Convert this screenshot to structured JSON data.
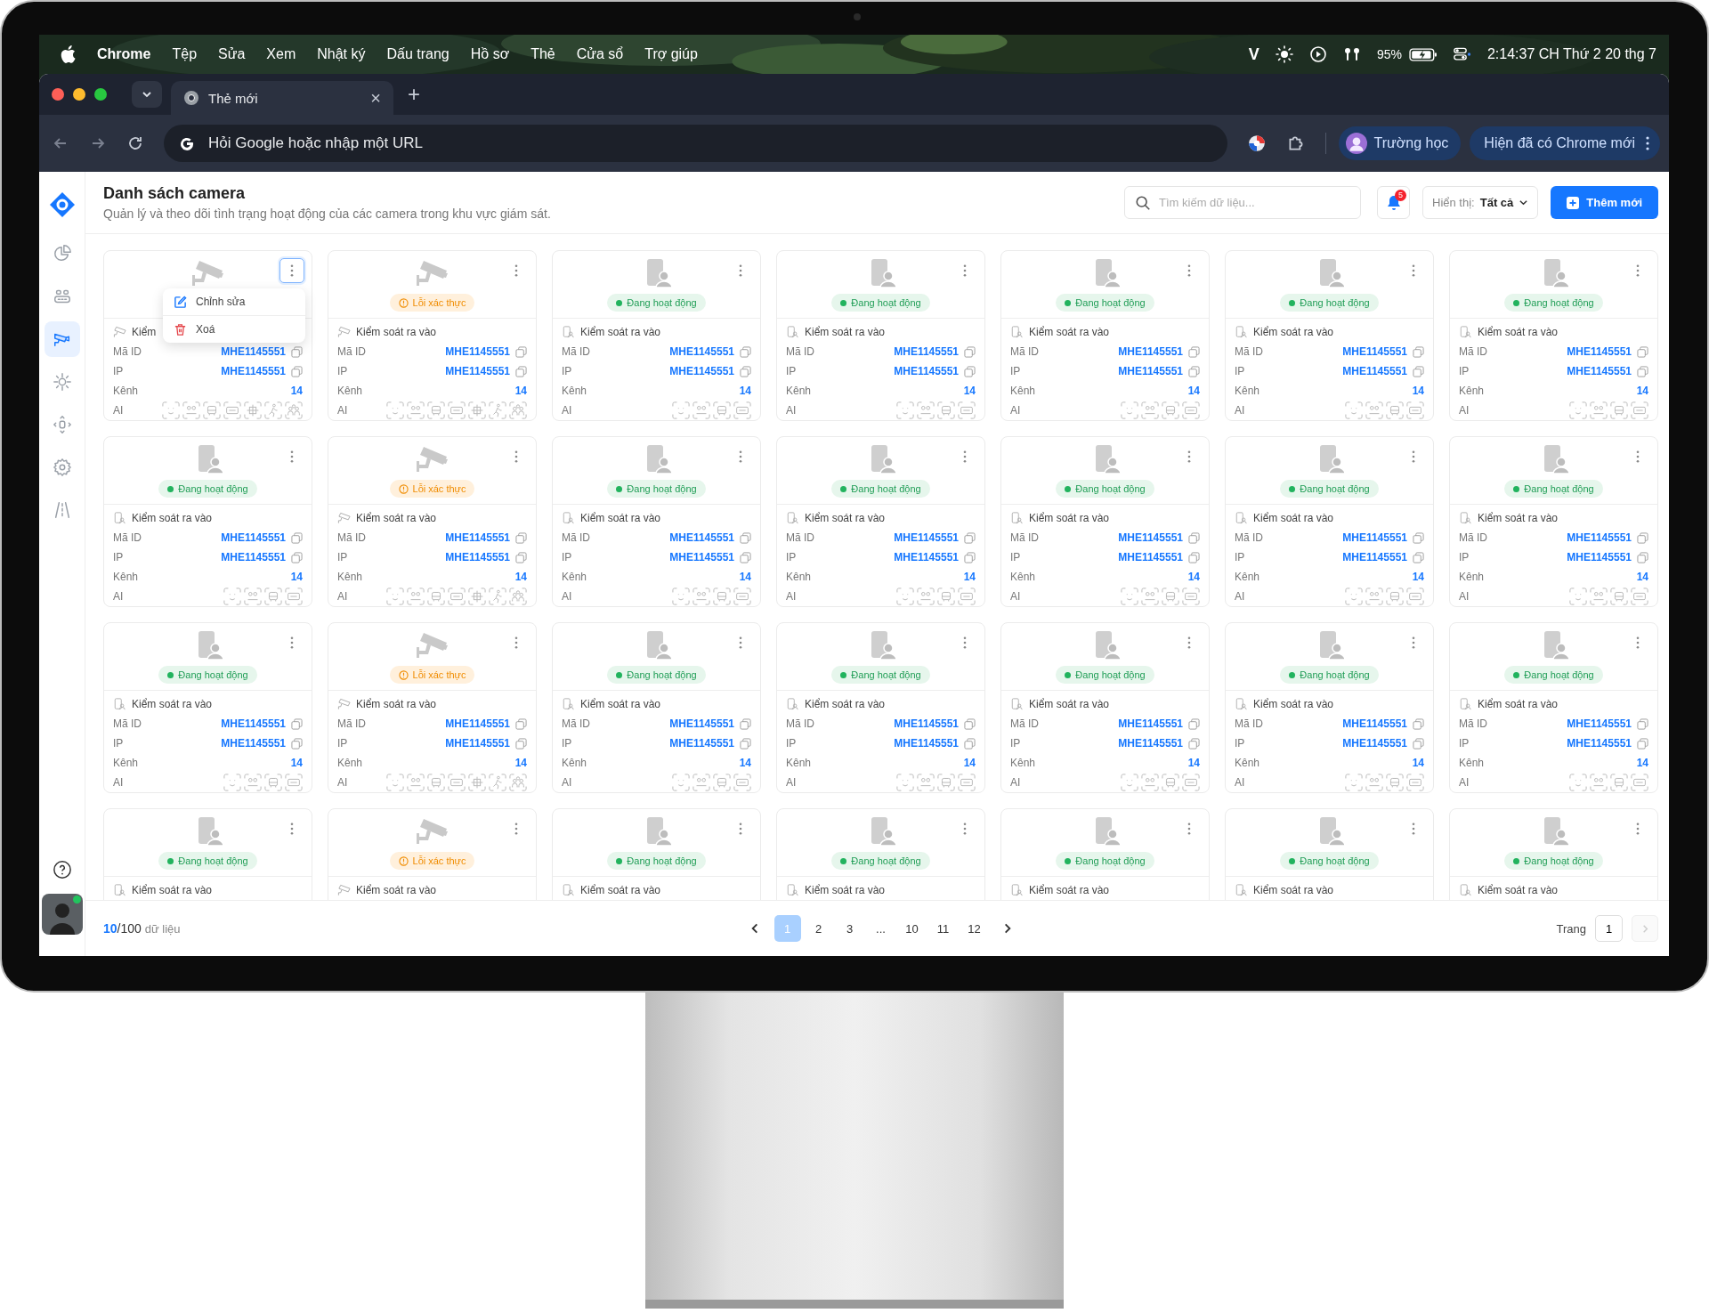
{
  "menubar": {
    "app": "Chrome",
    "items": [
      "Tệp",
      "Sửa",
      "Xem",
      "Nhật ký",
      "Dấu trang",
      "Hồ sơ",
      "Thẻ",
      "Cửa sổ",
      "Trợ giúp"
    ],
    "input_mode": "V",
    "battery": "95%",
    "clock": "2:14:37 CH Thứ 2 20 thg 7"
  },
  "browser": {
    "tabs": [
      {
        "title": "Thẻ mới",
        "selected": true,
        "close": "×"
      }
    ],
    "new_tab": "+",
    "address_placeholder": "Hỏi Google hoặc nhập một URL",
    "profile": "Trường học",
    "update": "Hiện đã có Chrome mới"
  },
  "sidebar": {
    "items": [
      {
        "kind": "chart",
        "selected": false
      },
      {
        "kind": "devices",
        "selected": false
      },
      {
        "kind": "camera",
        "selected": true
      },
      {
        "kind": "sensor",
        "selected": false
      },
      {
        "kind": "move",
        "selected": false
      },
      {
        "kind": "settings",
        "selected": false
      },
      {
        "kind": "road",
        "selected": false
      }
    ],
    "user_online": true
  },
  "header": {
    "title": "Danh sách camera",
    "subtitle": "Quản lý và theo dõi tình trạng hoạt động của các camera trong khu vực giám sát.",
    "search_placeholder": "Tìm kiếm dữ liệu...",
    "notifications": "5",
    "filter_label": "Hiển thị:",
    "filter_value": "Tất cả",
    "add_button": "Thêm mới"
  },
  "cards": [
    {
      "kind": "camera",
      "menu_open": true,
      "menu": [
        {
          "kind": "edit",
          "label": "Chỉnh sửa"
        },
        {
          "kind": "delete",
          "label": "Xoá"
        }
      ],
      "type": "Kiểm",
      "id_label": "Mã ID",
      "id": "MHE1145551",
      "ip_label": "IP",
      "ip": "MHE1145551",
      "channel_label": "Kênh",
      "channel": "14",
      "ai_label": "AI",
      "ai": [
        {
          "kind": "face"
        },
        {
          "kind": "people"
        },
        {
          "kind": "car"
        },
        {
          "kind": "plate"
        },
        {
          "kind": "crop"
        },
        {
          "kind": "walk"
        },
        {
          "kind": "group"
        }
      ]
    },
    {
      "kind": "camera",
      "status": {
        "kind": "error",
        "label": "Lỗi xác thực"
      },
      "menu_open": false,
      "type": "Kiểm soát ra vào",
      "id_label": "Mã ID",
      "id": "MHE1145551",
      "ip_label": "IP",
      "ip": "MHE1145551",
      "channel_label": "Kênh",
      "channel": "14",
      "ai_label": "AI",
      "ai": [
        {
          "kind": "face"
        },
        {
          "kind": "people"
        },
        {
          "kind": "car"
        },
        {
          "kind": "plate"
        },
        {
          "kind": "crop"
        },
        {
          "kind": "walk"
        },
        {
          "kind": "group"
        }
      ]
    },
    {
      "kind": "door",
      "status": {
        "kind": "active",
        "label": "Đang hoạt động"
      },
      "menu_open": false,
      "type": "Kiểm soát ra vào",
      "id_label": "Mã ID",
      "id": "MHE1145551",
      "ip_label": "IP",
      "ip": "MHE1145551",
      "channel_label": "Kênh",
      "channel": "14",
      "ai_label": "AI",
      "ai": [
        {
          "kind": "face"
        },
        {
          "kind": "people"
        },
        {
          "kind": "car"
        },
        {
          "kind": "plate"
        }
      ]
    },
    {
      "kind": "door",
      "status": {
        "kind": "active",
        "label": "Đang hoạt động"
      },
      "menu_open": false,
      "type": "Kiểm soát ra vào",
      "id_label": "Mã ID",
      "id": "MHE1145551",
      "ip_label": "IP",
      "ip": "MHE1145551",
      "channel_label": "Kênh",
      "channel": "14",
      "ai_label": "AI",
      "ai": [
        {
          "kind": "face"
        },
        {
          "kind": "people"
        },
        {
          "kind": "car"
        },
        {
          "kind": "plate"
        }
      ]
    },
    {
      "kind": "door",
      "status": {
        "kind": "active",
        "label": "Đang hoạt động"
      },
      "menu_open": false,
      "type": "Kiểm soát ra vào",
      "id_label": "Mã ID",
      "id": "MHE1145551",
      "ip_label": "IP",
      "ip": "MHE1145551",
      "channel_label": "Kênh",
      "channel": "14",
      "ai_label": "AI",
      "ai": [
        {
          "kind": "face"
        },
        {
          "kind": "people"
        },
        {
          "kind": "car"
        },
        {
          "kind": "plate"
        }
      ]
    },
    {
      "kind": "door",
      "status": {
        "kind": "active",
        "label": "Đang hoạt động"
      },
      "menu_open": false,
      "type": "Kiểm soát ra vào",
      "id_label": "Mã ID",
      "id": "MHE1145551",
      "ip_label": "IP",
      "ip": "MHE1145551",
      "channel_label": "Kênh",
      "channel": "14",
      "ai_label": "AI",
      "ai": [
        {
          "kind": "face"
        },
        {
          "kind": "people"
        },
        {
          "kind": "car"
        },
        {
          "kind": "plate"
        }
      ]
    },
    {
      "kind": "door",
      "status": {
        "kind": "active",
        "label": "Đang hoạt động"
      },
      "menu_open": false,
      "type": "Kiểm soát ra vào",
      "id_label": "Mã ID",
      "id": "MHE1145551",
      "ip_label": "IP",
      "ip": "MHE1145551",
      "channel_label": "Kênh",
      "channel": "14",
      "ai_label": "AI",
      "ai": [
        {
          "kind": "face"
        },
        {
          "kind": "people"
        },
        {
          "kind": "car"
        },
        {
          "kind": "plate"
        }
      ]
    },
    {
      "kind": "door",
      "status": {
        "kind": "active",
        "label": "Đang hoạt động"
      },
      "menu_open": false,
      "type": "Kiểm soát ra vào",
      "id_label": "Mã ID",
      "id": "MHE1145551",
      "ip_label": "IP",
      "ip": "MHE1145551",
      "channel_label": "Kênh",
      "channel": "14",
      "ai_label": "AI",
      "ai": [
        {
          "kind": "face"
        },
        {
          "kind": "people"
        },
        {
          "kind": "car"
        },
        {
          "kind": "plate"
        }
      ]
    },
    {
      "kind": "camera",
      "status": {
        "kind": "error",
        "label": "Lỗi xác thực"
      },
      "menu_open": false,
      "type": "Kiểm soát ra vào",
      "id_label": "Mã ID",
      "id": "MHE1145551",
      "ip_label": "IP",
      "ip": "MHE1145551",
      "channel_label": "Kênh",
      "channel": "14",
      "ai_label": "AI",
      "ai": [
        {
          "kind": "face"
        },
        {
          "kind": "people"
        },
        {
          "kind": "car"
        },
        {
          "kind": "plate"
        },
        {
          "kind": "crop"
        },
        {
          "kind": "walk"
        },
        {
          "kind": "group"
        }
      ]
    },
    {
      "kind": "door",
      "status": {
        "kind": "active",
        "label": "Đang hoạt động"
      },
      "menu_open": false,
      "type": "Kiểm soát ra vào",
      "id_label": "Mã ID",
      "id": "MHE1145551",
      "ip_label": "IP",
      "ip": "MHE1145551",
      "channel_label": "Kênh",
      "channel": "14",
      "ai_label": "AI",
      "ai": [
        {
          "kind": "face"
        },
        {
          "kind": "people"
        },
        {
          "kind": "car"
        },
        {
          "kind": "plate"
        }
      ]
    },
    {
      "kind": "door",
      "status": {
        "kind": "active",
        "label": "Đang hoạt động"
      },
      "menu_open": false,
      "type": "Kiểm soát ra vào",
      "id_label": "Mã ID",
      "id": "MHE1145551",
      "ip_label": "IP",
      "ip": "MHE1145551",
      "channel_label": "Kênh",
      "channel": "14",
      "ai_label": "AI",
      "ai": [
        {
          "kind": "face"
        },
        {
          "kind": "people"
        },
        {
          "kind": "car"
        },
        {
          "kind": "plate"
        }
      ]
    },
    {
      "kind": "door",
      "status": {
        "kind": "active",
        "label": "Đang hoạt động"
      },
      "menu_open": false,
      "type": "Kiểm soát ra vào",
      "id_label": "Mã ID",
      "id": "MHE1145551",
      "ip_label": "IP",
      "ip": "MHE1145551",
      "channel_label": "Kênh",
      "channel": "14",
      "ai_label": "AI",
      "ai": [
        {
          "kind": "face"
        },
        {
          "kind": "people"
        },
        {
          "kind": "car"
        },
        {
          "kind": "plate"
        }
      ]
    },
    {
      "kind": "door",
      "status": {
        "kind": "active",
        "label": "Đang hoạt động"
      },
      "menu_open": false,
      "type": "Kiểm soát ra vào",
      "id_label": "Mã ID",
      "id": "MHE1145551",
      "ip_label": "IP",
      "ip": "MHE1145551",
      "channel_label": "Kênh",
      "channel": "14",
      "ai_label": "AI",
      "ai": [
        {
          "kind": "face"
        },
        {
          "kind": "people"
        },
        {
          "kind": "car"
        },
        {
          "kind": "plate"
        }
      ]
    },
    {
      "kind": "door",
      "status": {
        "kind": "active",
        "label": "Đang hoạt động"
      },
      "menu_open": false,
      "type": "Kiểm soát ra vào",
      "id_label": "Mã ID",
      "id": "MHE1145551",
      "ip_label": "IP",
      "ip": "MHE1145551",
      "channel_label": "Kênh",
      "channel": "14",
      "ai_label": "AI",
      "ai": [
        {
          "kind": "face"
        },
        {
          "kind": "people"
        },
        {
          "kind": "car"
        },
        {
          "kind": "plate"
        }
      ]
    },
    {
      "kind": "door",
      "status": {
        "kind": "active",
        "label": "Đang hoạt động"
      },
      "menu_open": false,
      "type": "Kiểm soát ra vào",
      "id_label": "Mã ID",
      "id": "MHE1145551",
      "ip_label": "IP",
      "ip": "MHE1145551",
      "channel_label": "Kênh",
      "channel": "14",
      "ai_label": "AI",
      "ai": [
        {
          "kind": "face"
        },
        {
          "kind": "people"
        },
        {
          "kind": "car"
        },
        {
          "kind": "plate"
        }
      ]
    },
    {
      "kind": "camera",
      "status": {
        "kind": "error",
        "label": "Lỗi xác thực"
      },
      "menu_open": false,
      "type": "Kiểm soát ra vào",
      "id_label": "Mã ID",
      "id": "MHE1145551",
      "ip_label": "IP",
      "ip": "MHE1145551",
      "channel_label": "Kênh",
      "channel": "14",
      "ai_label": "AI",
      "ai": [
        {
          "kind": "face"
        },
        {
          "kind": "people"
        },
        {
          "kind": "car"
        },
        {
          "kind": "plate"
        },
        {
          "kind": "crop"
        },
        {
          "kind": "walk"
        },
        {
          "kind": "group"
        }
      ]
    },
    {
      "kind": "door",
      "status": {
        "kind": "active",
        "label": "Đang hoạt động"
      },
      "menu_open": false,
      "type": "Kiểm soát ra vào",
      "id_label": "Mã ID",
      "id": "MHE1145551",
      "ip_label": "IP",
      "ip": "MHE1145551",
      "channel_label": "Kênh",
      "channel": "14",
      "ai_label": "AI",
      "ai": [
        {
          "kind": "face"
        },
        {
          "kind": "people"
        },
        {
          "kind": "car"
        },
        {
          "kind": "plate"
        }
      ]
    },
    {
      "kind": "door",
      "status": {
        "kind": "active",
        "label": "Đang hoạt động"
      },
      "menu_open": false,
      "type": "Kiểm soát ra vào",
      "id_label": "Mã ID",
      "id": "MHE1145551",
      "ip_label": "IP",
      "ip": "MHE1145551",
      "channel_label": "Kênh",
      "channel": "14",
      "ai_label": "AI",
      "ai": [
        {
          "kind": "face"
        },
        {
          "kind": "people"
        },
        {
          "kind": "car"
        },
        {
          "kind": "plate"
        }
      ]
    },
    {
      "kind": "door",
      "status": {
        "kind": "active",
        "label": "Đang hoạt động"
      },
      "menu_open": false,
      "type": "Kiểm soát ra vào",
      "id_label": "Mã ID",
      "id": "MHE1145551",
      "ip_label": "IP",
      "ip": "MHE1145551",
      "channel_label": "Kênh",
      "channel": "14",
      "ai_label": "AI",
      "ai": [
        {
          "kind": "face"
        },
        {
          "kind": "people"
        },
        {
          "kind": "car"
        },
        {
          "kind": "plate"
        }
      ]
    },
    {
      "kind": "door",
      "status": {
        "kind": "active",
        "label": "Đang hoạt động"
      },
      "menu_open": false,
      "type": "Kiểm soát ra vào",
      "id_label": "Mã ID",
      "id": "MHE1145551",
      "ip_label": "IP",
      "ip": "MHE1145551",
      "channel_label": "Kênh",
      "channel": "14",
      "ai_label": "AI",
      "ai": [
        {
          "kind": "face"
        },
        {
          "kind": "people"
        },
        {
          "kind": "car"
        },
        {
          "kind": "plate"
        }
      ]
    },
    {
      "kind": "door",
      "status": {
        "kind": "active",
        "label": "Đang hoạt động"
      },
      "menu_open": false,
      "type": "Kiểm soát ra vào",
      "id_label": "Mã ID",
      "id": "MHE1145551",
      "ip_label": "IP",
      "ip": "MHE1145551",
      "channel_label": "Kênh",
      "channel": "14",
      "ai_label": "AI",
      "ai": [
        {
          "kind": "face"
        },
        {
          "kind": "people"
        },
        {
          "kind": "car"
        },
        {
          "kind": "plate"
        }
      ]
    },
    {
      "kind": "door",
      "status": {
        "kind": "active",
        "label": "Đang hoạt động"
      },
      "menu_open": false,
      "type": "Kiểm soát ra vào"
    },
    {
      "kind": "camera",
      "status": {
        "kind": "error",
        "label": "Lỗi xác thực"
      },
      "menu_open": false,
      "type": "Kiểm soát ra vào"
    },
    {
      "kind": "door",
      "status": {
        "kind": "active",
        "label": "Đang hoạt động"
      },
      "menu_open": false,
      "type": "Kiểm soát ra vào"
    },
    {
      "kind": "door",
      "status": {
        "kind": "active",
        "label": "Đang hoạt động"
      },
      "menu_open": false,
      "type": "Kiểm soát ra vào"
    },
    {
      "kind": "door",
      "status": {
        "kind": "active",
        "label": "Đang hoạt động"
      },
      "menu_open": false,
      "type": "Kiểm soát ra vào"
    },
    {
      "kind": "door",
      "status": {
        "kind": "active",
        "label": "Đang hoạt động"
      },
      "menu_open": false,
      "type": "Kiểm soát ra vào"
    },
    {
      "kind": "door",
      "status": {
        "kind": "active",
        "label": "Đang hoạt động"
      },
      "menu_open": false,
      "type": "Kiểm soát ra vào"
    }
  ],
  "footer": {
    "shown": "10",
    "total": "/100",
    "unit": "dữ liệu",
    "pages": [
      {
        "label": "1",
        "selected": true
      },
      {
        "label": "2",
        "selected": false
      },
      {
        "label": "3",
        "selected": false
      },
      {
        "label": "...",
        "selected": false
      },
      {
        "label": "10",
        "selected": false
      },
      {
        "label": "11",
        "selected": false
      },
      {
        "label": "12",
        "selected": false
      }
    ],
    "page_label": "Trang",
    "page_value": "1",
    "next_disabled": true
  }
}
